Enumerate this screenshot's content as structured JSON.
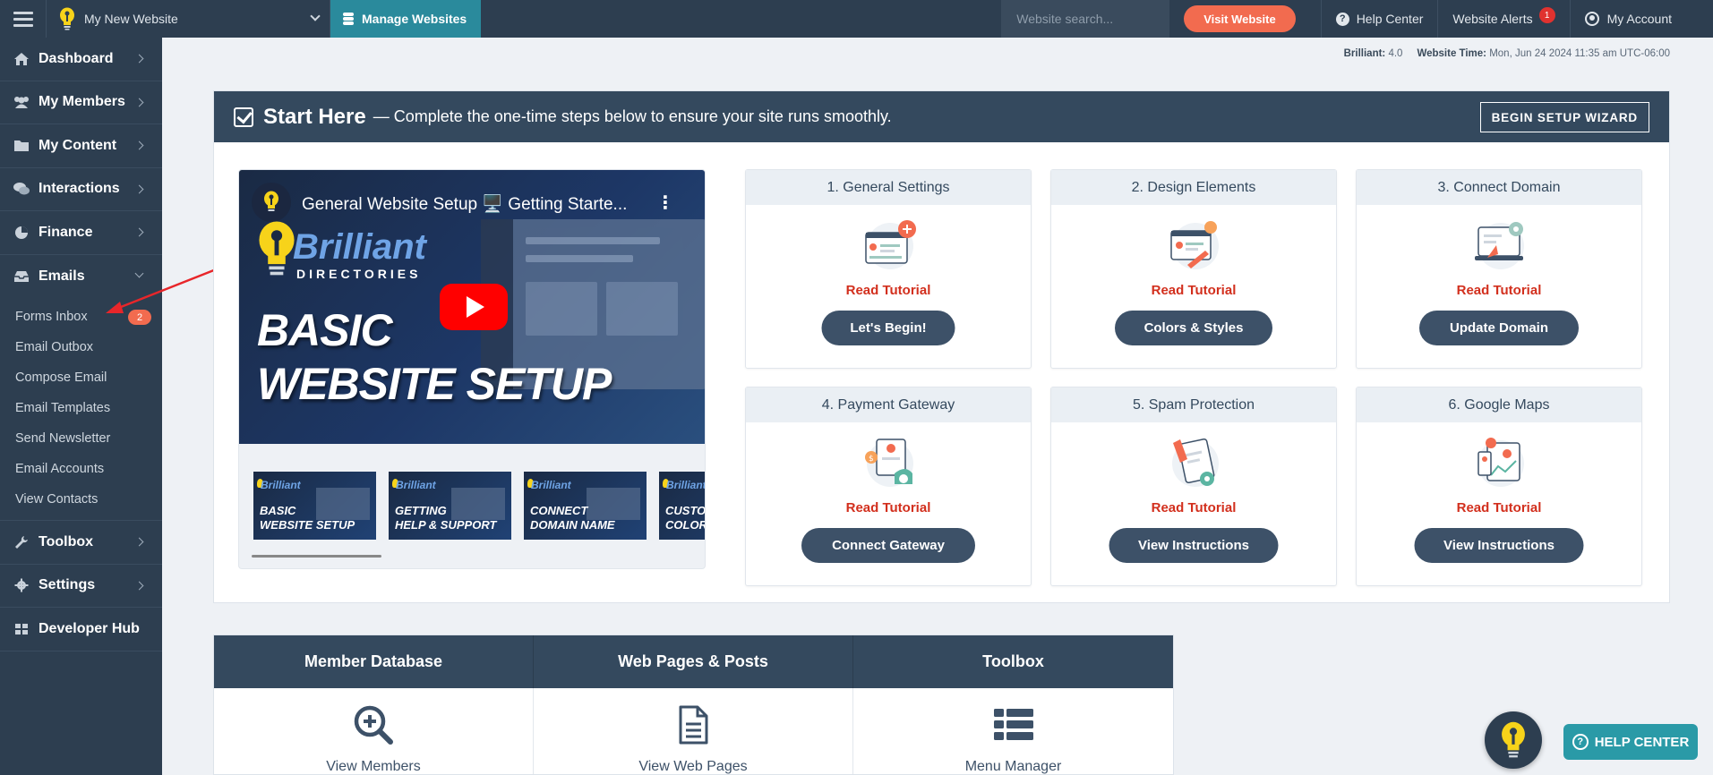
{
  "topbar": {
    "site_name": "My New Website",
    "manage_label": "Manage Websites",
    "search_placeholder": "Website search...",
    "visit_label": "Visit Website",
    "help_label": "Help Center",
    "alerts_label": "Website Alerts",
    "alerts_count": "1",
    "account_label": "My Account"
  },
  "sidebar": {
    "items": [
      {
        "label": "Dashboard",
        "icon": "home-icon"
      },
      {
        "label": "My Members",
        "icon": "users-icon"
      },
      {
        "label": "My Content",
        "icon": "folder-icon"
      },
      {
        "label": "Interactions",
        "icon": "comments-icon"
      },
      {
        "label": "Finance",
        "icon": "pie-chart-icon"
      },
      {
        "label": "Emails",
        "icon": "inbox-icon"
      }
    ],
    "email_sub": [
      {
        "label": "Forms Inbox",
        "badge": "2"
      },
      {
        "label": "Email Outbox"
      },
      {
        "label": "Compose Email"
      },
      {
        "label": "Email Templates"
      },
      {
        "label": "Send Newsletter"
      },
      {
        "label": "Email Accounts"
      },
      {
        "label": "View Contacts"
      }
    ],
    "items_after": [
      {
        "label": "Toolbox",
        "icon": "wrench-icon"
      },
      {
        "label": "Settings",
        "icon": "gear-icon"
      },
      {
        "label": "Developer Hub",
        "icon": "grid-icon"
      }
    ]
  },
  "status": {
    "version_label": "Brilliant:",
    "version": "4.0",
    "time_label": "Website Time:",
    "time": "Mon, Jun 24 2024 11:35 am UTC-06:00"
  },
  "start": {
    "title": "Start Here",
    "subtitle": "— Complete the one-time steps below to ensure your site runs smoothly.",
    "wizard_label": "BEGIN SETUP WIZARD"
  },
  "video": {
    "title": "General Website Setup 🖥️ Getting Starte...",
    "brand": "Brilliant",
    "brand_sub": "DIRECTORIES",
    "big_line1": "BASIC",
    "big_line2": "WEBSITE SETUP",
    "thumbs": [
      {
        "l1": "BASIC",
        "l2": "WEBSITE SETUP"
      },
      {
        "l1": "GETTING",
        "l2": "HELP & SUPPORT"
      },
      {
        "l1": "CONNECT",
        "l2": "DOMAIN NAME"
      },
      {
        "l1": "CUSTO",
        "l2": "COLOR"
      }
    ]
  },
  "steps": [
    {
      "title": "1. General Settings",
      "read": "Read Tutorial",
      "button": "Let's Begin!"
    },
    {
      "title": "2. Design Elements",
      "read": "Read Tutorial",
      "button": "Colors & Styles"
    },
    {
      "title": "3. Connect Domain",
      "read": "Read Tutorial",
      "button": "Update Domain"
    },
    {
      "title": "4. Payment Gateway",
      "read": "Read Tutorial",
      "button": "Connect Gateway"
    },
    {
      "title": "5. Spam Protection",
      "read": "Read Tutorial",
      "button": "View Instructions"
    },
    {
      "title": "6. Google Maps",
      "read": "Read Tutorial",
      "button": "View Instructions"
    }
  ],
  "tabs": [
    {
      "header": "Member Database",
      "action": "View Members",
      "icon": "search-plus-icon"
    },
    {
      "header": "Web Pages & Posts",
      "action": "View Web Pages",
      "icon": "document-icon"
    },
    {
      "header": "Toolbox",
      "action": "Menu Manager",
      "icon": "list-icon"
    }
  ],
  "help_center_label": "HELP CENTER",
  "colors": {
    "nav_bg": "#2d3e50",
    "accent_teal": "#2a8a9c",
    "visit_orange": "#f26b4f",
    "tutorial_red": "#d22f1d",
    "button_slate": "#3d5168"
  }
}
